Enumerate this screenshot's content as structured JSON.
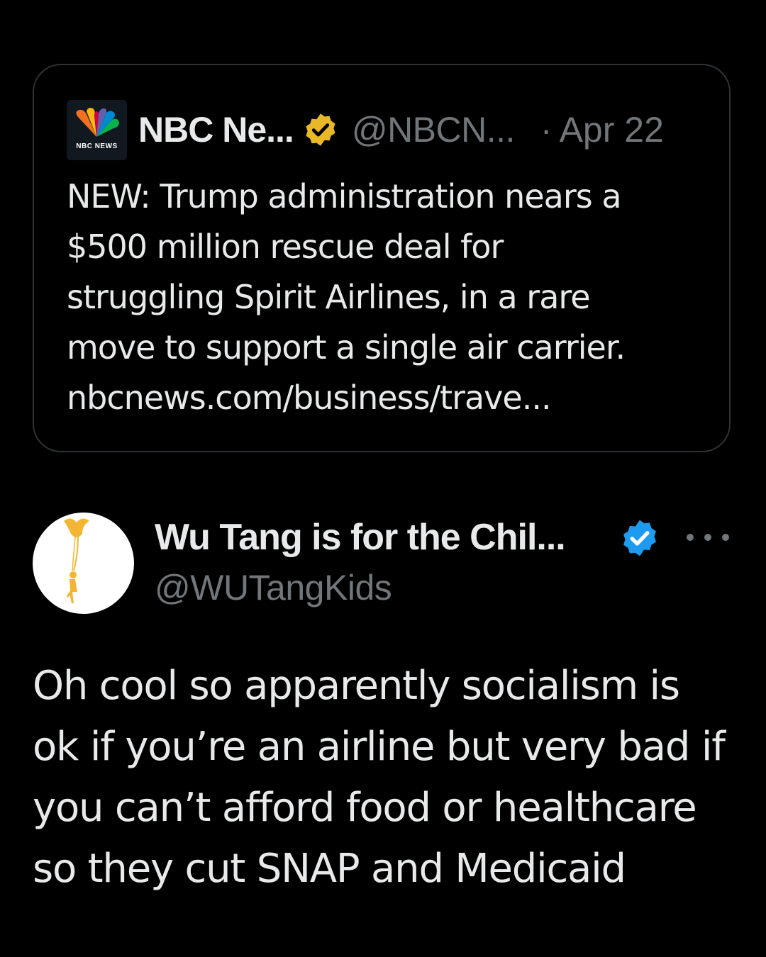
{
  "quoted_tweet": {
    "author_name": "NBC Ne...",
    "logo_text": "NBC NEWS",
    "handle": "@NBCN...",
    "separator": "·",
    "date": "Apr 22",
    "badge_color": "#e8b829",
    "text_lines": [
      "NEW: Trump administration nears a",
      "$500 million rescue deal for",
      "struggling Spirit Airlines, in a rare",
      "move to support a single air carrier.",
      "nbcnews.com/business/trave..."
    ]
  },
  "tweet": {
    "author_name": "Wu Tang is for the Chil...",
    "handle": "@WUTangKids",
    "badge_color": "#1d9bf0",
    "more_icon": "more-horizontal-icon",
    "text_lines": [
      "Oh cool so apparently socialism is",
      "ok if you’re an airline but very bad if",
      "you can’t afford food or healthcare",
      "so they cut SNAP and Medicaid"
    ]
  },
  "colors": {
    "background": "#000000",
    "text_primary": "#e7e9ea",
    "text_secondary": "#71767b",
    "border": "#2f3336"
  }
}
